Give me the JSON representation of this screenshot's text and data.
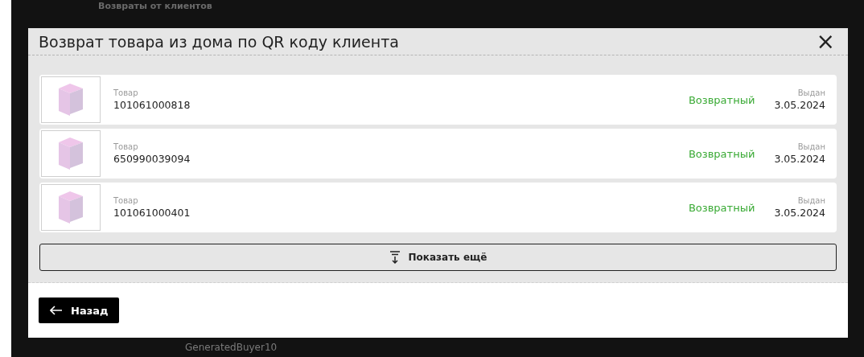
{
  "background": {
    "heading": "Возвраты от клиентов",
    "buyer": "GeneratedBuyer10"
  },
  "dialog": {
    "title": "Возврат товара из дома по QR коду клиента",
    "close": "×",
    "items": [
      {
        "label": "Товар",
        "code": "101061000818",
        "status": "Возвратный",
        "date_label": "Выдан",
        "date": "3.05.2024"
      },
      {
        "label": "Товар",
        "code": "650990039094",
        "status": "Возвратный",
        "date_label": "Выдан",
        "date": "3.05.2024"
      },
      {
        "label": "Товар",
        "code": "101061000401",
        "status": "Возвратный",
        "date_label": "Выдан",
        "date": "3.05.2024"
      }
    ],
    "show_more": "Показать ещё",
    "back": "Назад"
  }
}
